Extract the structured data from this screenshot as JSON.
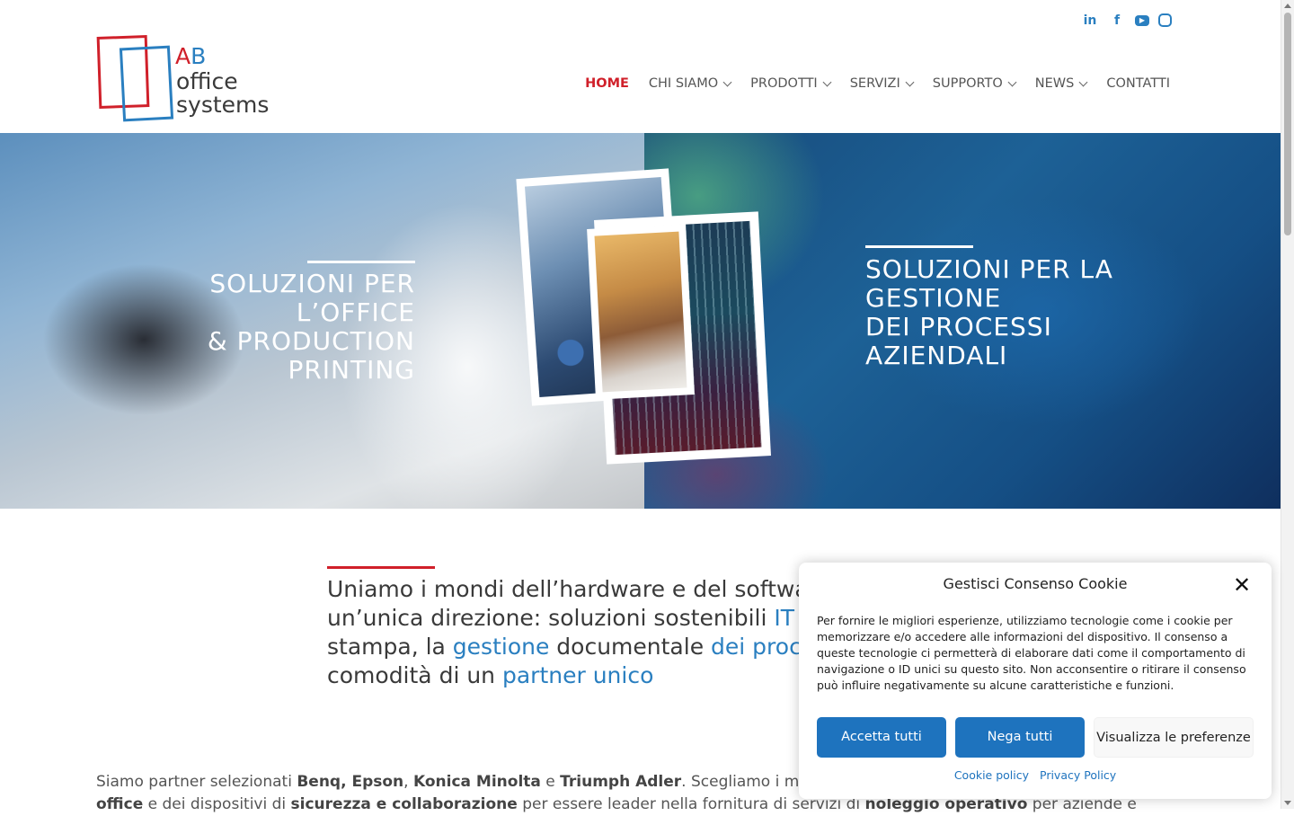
{
  "brand": {
    "logo_ab_a": "A",
    "logo_ab_b": "B",
    "logo_line2": "office",
    "logo_line3": "systems",
    "colors": {
      "red": "#d0202a",
      "blue": "#2a7fc0"
    }
  },
  "social": {
    "linkedin": "in",
    "facebook": "f",
    "youtube": "▶",
    "instagram": ""
  },
  "nav": {
    "home": "HOME",
    "chi_siamo": "CHI SIAMO",
    "prodotti": "PRODOTTI",
    "servizi": "SERVIZI",
    "supporto": "SUPPORTO",
    "news": "NEWS",
    "contatti": "CONTATTI"
  },
  "hero": {
    "left_line1": "SOLUZIONI PER L’OFFICE",
    "left_line2": "& PRODUCTION",
    "left_line3": "PRINTING",
    "right_line1": "SOLUZIONI PER LA",
    "right_line2": "GESTIONE",
    "right_line3": "DEI PROCESSI",
    "right_line4": "AZIENDALI"
  },
  "intro": {
    "p1": "Uniamo i mondi dell’hardware e del softwar",
    "p2": "un’unica direzione: soluzioni sostenibili ",
    "p2_hl": "IT",
    "p2_end": " e",
    "p3": "stampa, la ",
    "p3_hl1": "gestione",
    "p3_mid": " documentale ",
    "p3_hl2": "dei proces",
    "p4": "comodità di un ",
    "p4_hl": "partner unico"
  },
  "paragraph": {
    "s1": "Siamo partner selezionati ",
    "b1": "Benq, Epson",
    "s2": ", ",
    "b2": "Konica Minolta",
    "s3": " e ",
    "b3": "Triumph Adler",
    "s4": ". Scegliamo i m",
    "b4": "office",
    "s5": " e dei dispositivi di ",
    "b5": "sicurezza e collaborazione",
    "s6": " per essere leader nella fornitura di servizi di ",
    "b6": "noleggio operativo",
    "s7": " per aziende e"
  },
  "cookie": {
    "title": "Gestisci Consenso Cookie",
    "close": "✕",
    "text": "Per fornire le migliori esperienze, utilizziamo tecnologie come i cookie per memorizzare e/o accedere alle informazioni del dispositivo. Il consenso a queste tecnologie ci permetterà di elaborare dati come il comportamento di navigazione o ID unici su questo sito. Non acconsentire o ritirare il consenso può influire negativamente su alcune caratteristiche e funzioni.",
    "accept": "Accetta tutti",
    "deny": "Nega tutti",
    "prefs": "Visualizza le preferenze",
    "cookie_policy": "Cookie policy",
    "privacy_policy": "Privacy Policy"
  }
}
